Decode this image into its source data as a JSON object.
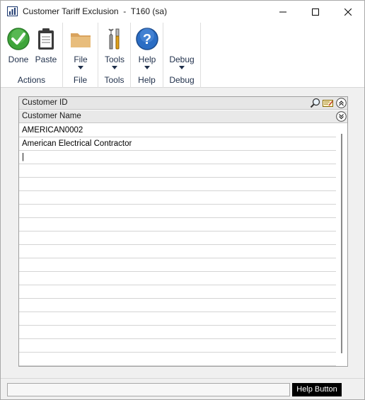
{
  "window": {
    "title": "Customer Tariff Exclusion  -  T160 (sa)"
  },
  "ribbon": {
    "groups": [
      {
        "label": "Actions",
        "buttons": [
          {
            "label": "Done",
            "icon": "check-icon"
          },
          {
            "label": "Paste",
            "icon": "clipboard-icon"
          }
        ]
      },
      {
        "label": "File",
        "buttons": [
          {
            "label": "File",
            "icon": "folder-icon"
          }
        ]
      },
      {
        "label": "Tools",
        "buttons": [
          {
            "label": "Tools",
            "icon": "tools-icon"
          }
        ]
      },
      {
        "label": "Help",
        "buttons": [
          {
            "label": "Help",
            "icon": "help-icon"
          }
        ]
      },
      {
        "label": "Debug",
        "buttons": [
          {
            "label": "Debug",
            "icon": "debug-icon"
          }
        ]
      }
    ]
  },
  "grid": {
    "header1": "Customer ID",
    "header2": "Customer Name",
    "rows": [
      "AMERICAN0002",
      "American Electrical Contractor",
      "|",
      "",
      "",
      "",
      "",
      "",
      "",
      "",
      "",
      "",
      "",
      "",
      "",
      "",
      "",
      "",
      ""
    ]
  },
  "statusbar": {
    "status_text": "",
    "help_label": "Help Button"
  },
  "colors": {
    "done_green": "#3fa53b",
    "help_blue": "#2b6dc4",
    "folder_tan": "#d9a35e"
  }
}
